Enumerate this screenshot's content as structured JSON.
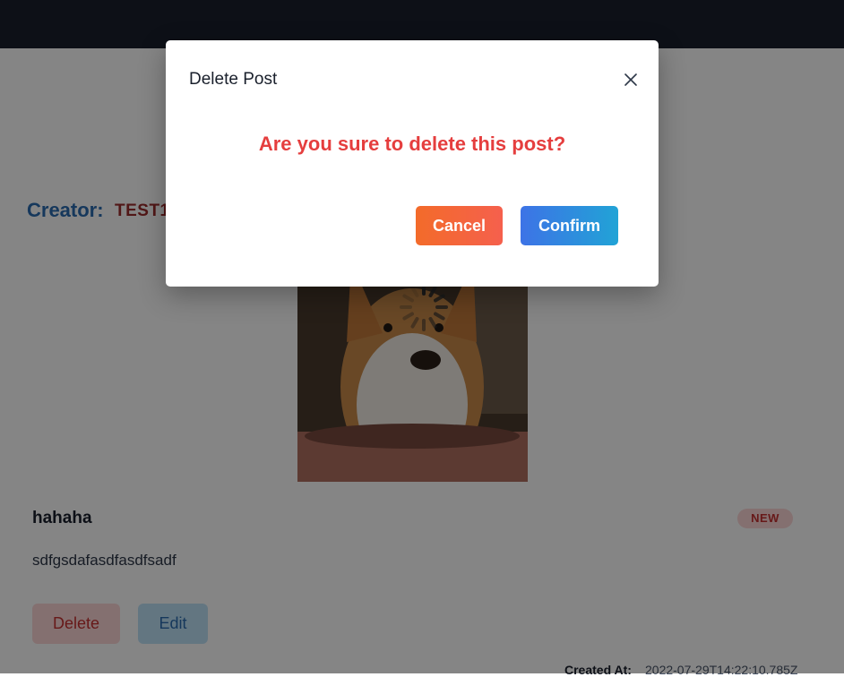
{
  "post": {
    "creator_label": "Creator:",
    "creator_name": "TEST1",
    "title": "hahaha",
    "badge": "NEW",
    "body": "sdfgsdafasdfasdfsadf",
    "delete_label": "Delete",
    "edit_label": "Edit",
    "created_label": "Created At:",
    "created_value": "2022-07-29T14:22:10.785Z"
  },
  "modal": {
    "title": "Delete Post",
    "question": "Are you sure to delete this post?",
    "cancel_label": "Cancel",
    "confirm_label": "Confirm"
  },
  "icons": {
    "close": "close-icon",
    "spinner": "loading-spinner-icon"
  },
  "colors": {
    "navbar": "#1a202c",
    "creator_label": "#2b6cb0",
    "creator_name": "#9b2c2c",
    "question": "#e53e3e",
    "cancel_gradient": [
      "#f36b2a",
      "#f5604d"
    ],
    "confirm_gradient": [
      "#3d73e6",
      "#21a3d6"
    ]
  }
}
